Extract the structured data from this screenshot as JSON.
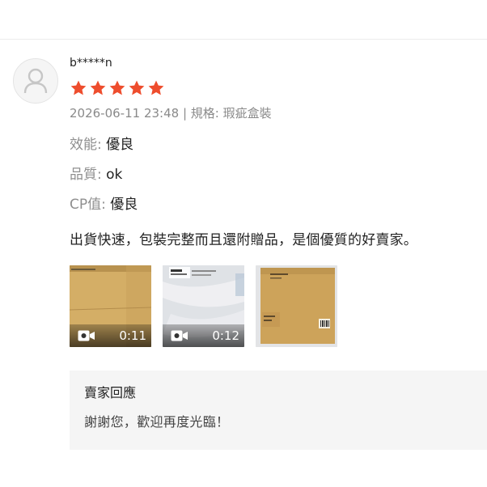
{
  "review": {
    "username": "b*****n",
    "rating": 5,
    "star_color": "#ee4d2d",
    "date": "2026-06-11 23:48",
    "separator": "|",
    "variation_label": "規格:",
    "variation_value": "瑕疵盒裝",
    "attributes": [
      {
        "key": "效能:",
        "value": "優良"
      },
      {
        "key": "品質:",
        "value": "ok"
      },
      {
        "key": "CP值:",
        "value": "優良"
      }
    ],
    "comment": "出貨快速，包裝完整而且還附贈品，是個優質的好賣家。",
    "media": [
      {
        "type": "video",
        "duration": "0:11",
        "icon": "video-camera-icon"
      },
      {
        "type": "video",
        "duration": "0:12",
        "icon": "video-camera-icon"
      },
      {
        "type": "image"
      }
    ]
  },
  "seller_reply": {
    "title": "賣家回應",
    "message": "謝謝您，歡迎再度光臨！"
  }
}
